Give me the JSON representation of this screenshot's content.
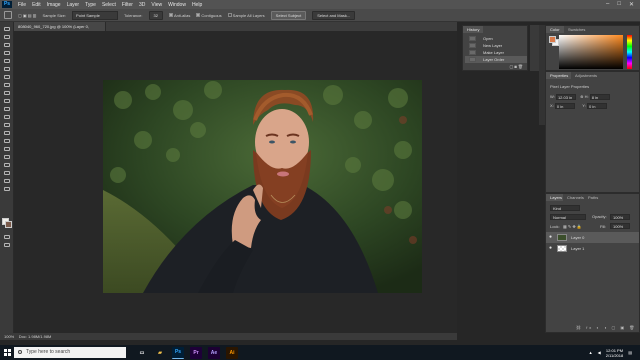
{
  "app": {
    "logo": "Ps"
  },
  "menu": [
    "File",
    "Edit",
    "Image",
    "Layer",
    "Type",
    "Select",
    "Filter",
    "3D",
    "View",
    "Window",
    "Help"
  ],
  "window_controls": [
    "minimize-icon",
    "maximize-icon",
    "close-icon"
  ],
  "options_bar": {
    "sample_size_label": "Sample Size:",
    "sample_size_value": "Point Sample",
    "tolerance_label": "Tolerance:",
    "tolerance_value": "32",
    "anti_alias_label": "Anti-alias",
    "contiguous_label": "Contiguous",
    "sample_all_layers_label": "Sample All Layers",
    "select_subject_label": "Select Subject",
    "select_mask_label": "Select and Mask..."
  },
  "document": {
    "tab_title": "808040_960_720.jpg @ 100% (Layer 0, RGB/8#) *",
    "zoom": "100%",
    "doc_size": "Doc: 1.98M/1.98M"
  },
  "history_panel": {
    "tab": "History",
    "items": [
      "Open",
      "New Layer",
      "Make Layer",
      "Layer Order"
    ],
    "selected_index": 3
  },
  "color_panel": {
    "tabs": [
      "Color",
      "Swatches"
    ],
    "foreground": "#d97a4a",
    "background": "#f2f2f2"
  },
  "properties_panel": {
    "tabs": [
      "Properties",
      "Adjustments"
    ],
    "section_label": "Pixel Layer Properties",
    "w_label": "W:",
    "w_value": "12.03 in",
    "h_label": "H:",
    "h_value": "8 in",
    "x_label": "X:",
    "x_value": "0 in",
    "y_label": "Y:",
    "y_value": "0 in"
  },
  "layers_panel": {
    "tabs": [
      "Layers",
      "Channels",
      "Paths"
    ],
    "filter_label": "Kind",
    "blend_mode": "Normal",
    "opacity_label": "Opacity:",
    "opacity_value": "100%",
    "lock_label": "Lock:",
    "fill_label": "Fill:",
    "fill_value": "100%",
    "layers": [
      {
        "name": "Layer 0",
        "selected": true
      },
      {
        "name": "Layer 1",
        "selected": false
      }
    ]
  },
  "taskbar": {
    "search_placeholder": "Type here to search",
    "apps": [
      "task-view",
      "file-explorer",
      "photoshop",
      "premiere",
      "after-effects",
      "illustrator"
    ],
    "time": "12:01 PM",
    "date": "2/11/2018"
  }
}
